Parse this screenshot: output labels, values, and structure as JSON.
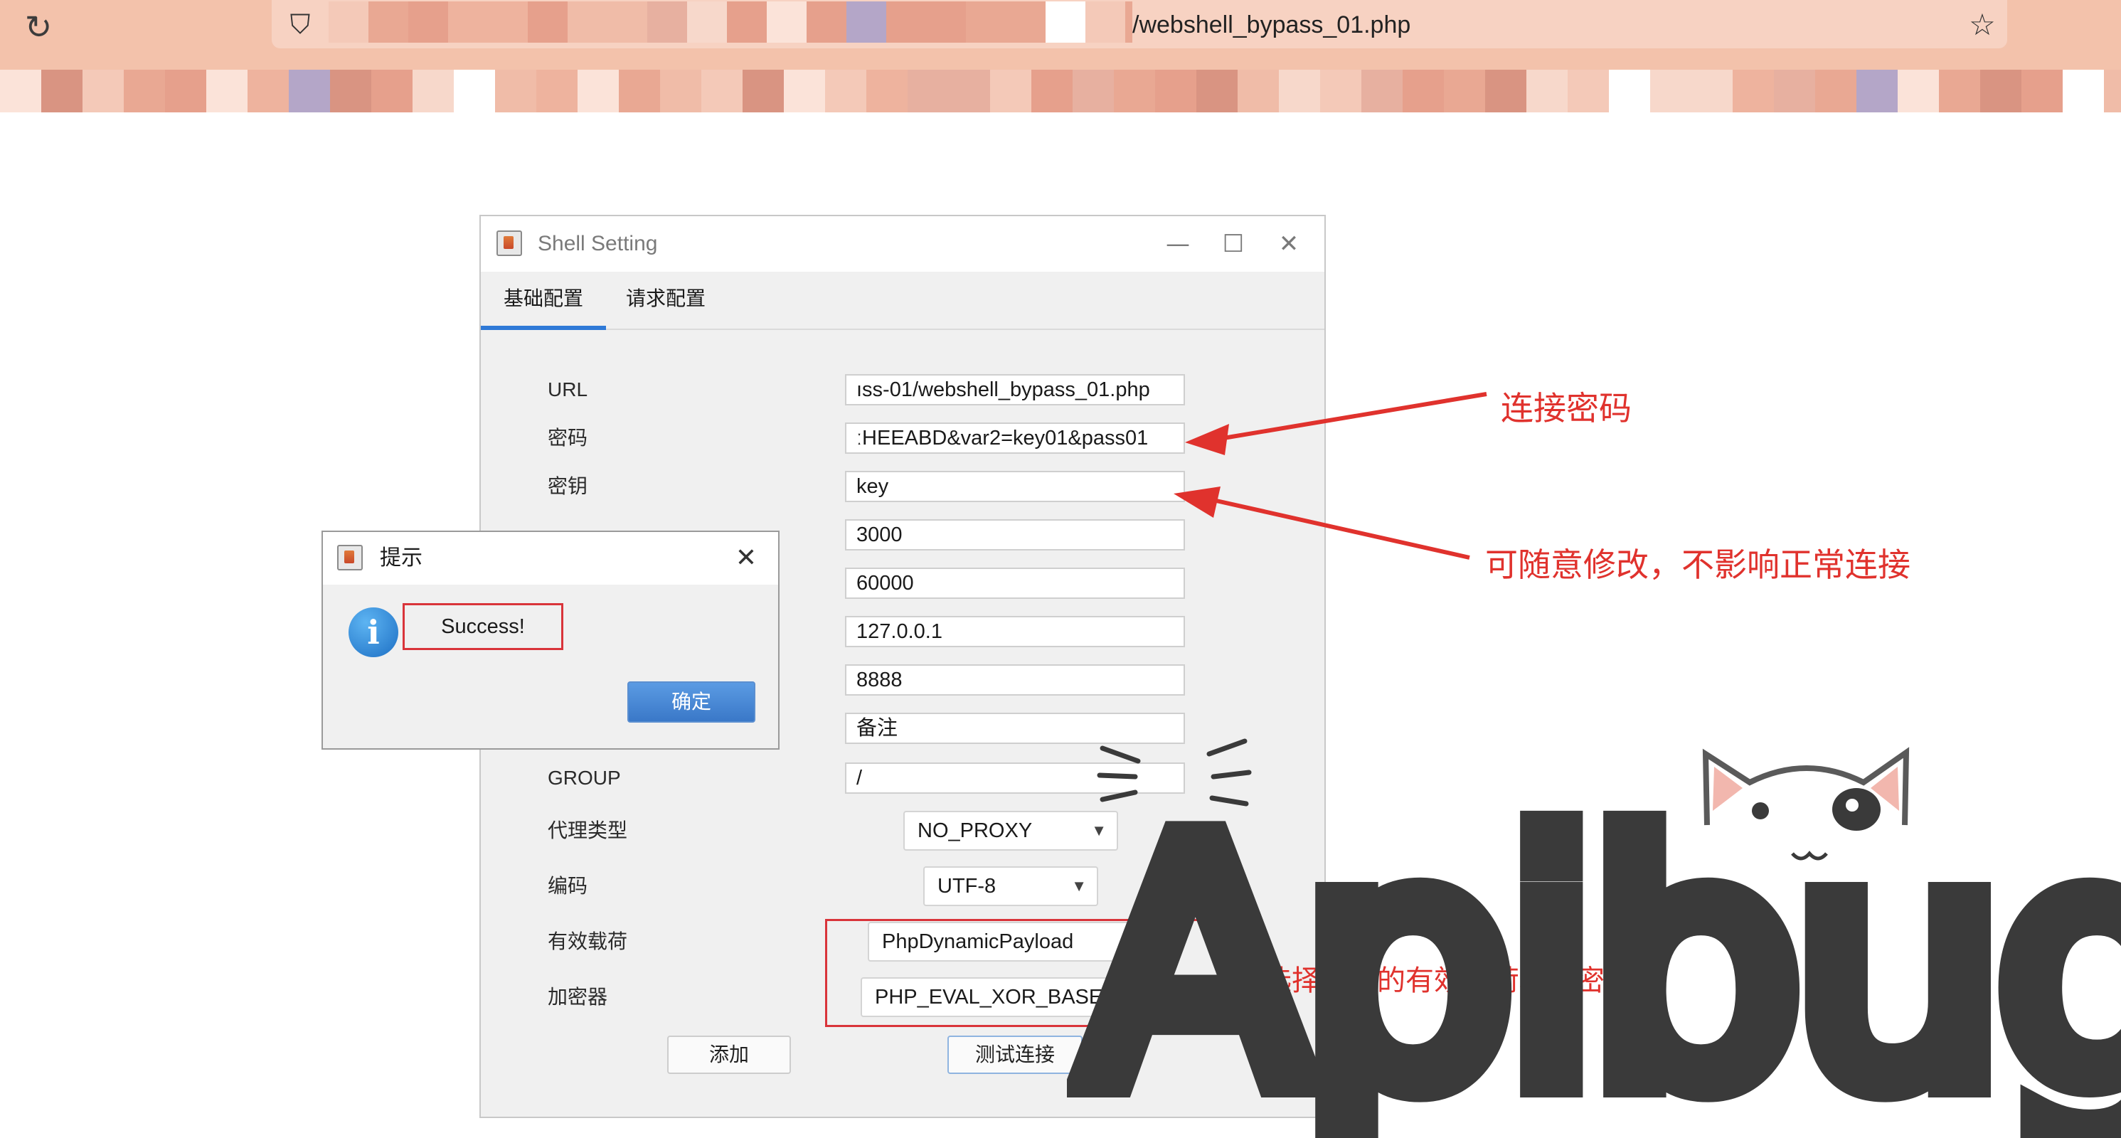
{
  "browser": {
    "url_visible": "/webshell_bypass_01.php",
    "icons": [
      "reload-icon",
      "shield-icon",
      "star-icon"
    ]
  },
  "window": {
    "title": "Shell Setting",
    "minimize": "—",
    "maximize": "☐",
    "close": "✕",
    "tabs": [
      {
        "label": "基础配置",
        "active": true
      },
      {
        "label": "请求配置",
        "active": false
      }
    ],
    "fields": [
      {
        "label": "URL",
        "value": "ıss-01/webshell_bypass_01.php"
      },
      {
        "label": "密码",
        "value": "ːHEEABD&var2=key01&pass01"
      },
      {
        "label": "密钥",
        "value": "key"
      },
      {
        "label": "",
        "value": "3000"
      },
      {
        "label": "",
        "value": "60000"
      },
      {
        "label": "",
        "value": "127.0.0.1"
      },
      {
        "label": "",
        "value": "8888"
      },
      {
        "label": "",
        "value": "备注"
      },
      {
        "label": "GROUP",
        "value": "/"
      }
    ],
    "selects": [
      {
        "label": "代理类型",
        "value": "NO_PROXY"
      },
      {
        "label": "编码",
        "value": "UTF-8"
      },
      {
        "label": "有效载荷",
        "value": "PhpDynamicPayload"
      },
      {
        "label": "加密器",
        "value": "PHP_EVAL_XOR_BASE64"
      }
    ],
    "buttons": {
      "add": "添加",
      "test": "测试连接"
    }
  },
  "dialog": {
    "title": "提示",
    "close": "✕",
    "message": "Success!",
    "ok": "确定"
  },
  "annotations": {
    "password_note": "连接密码",
    "key_note": "可随意修改，不影响正常连接",
    "payload_note": "选择合适的有效载荷和加密器",
    "color": "#e0322d"
  },
  "watermark": {
    "text": "Apibug"
  }
}
